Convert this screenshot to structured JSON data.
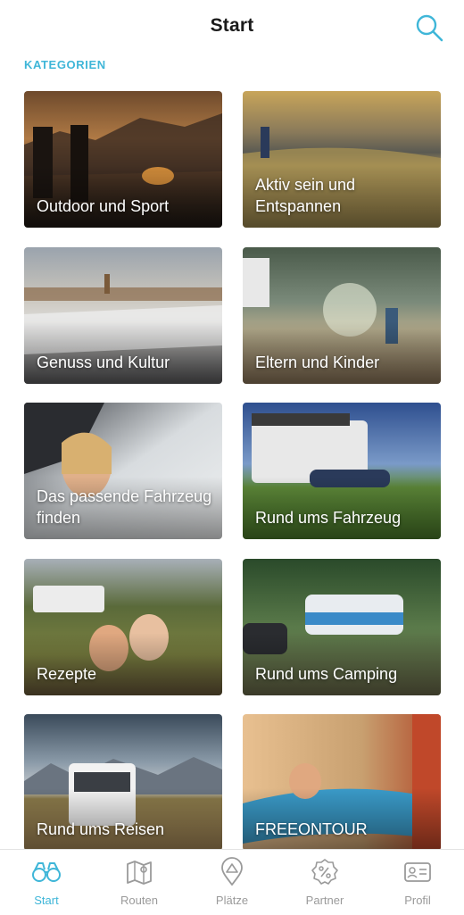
{
  "header": {
    "title": "Start",
    "search_icon": "search-icon"
  },
  "section": {
    "label": "KATEGORIEN"
  },
  "categories": [
    {
      "label": "Outdoor und Sport"
    },
    {
      "label": "Aktiv sein und Entspannen"
    },
    {
      "label": "Genuss und Kultur"
    },
    {
      "label": "Eltern und Kinder"
    },
    {
      "label": "Das passende Fahrzeug finden"
    },
    {
      "label": "Rund ums Fahrzeug"
    },
    {
      "label": "Rezepte"
    },
    {
      "label": "Rund ums Camping"
    },
    {
      "label": "Rund ums Reisen"
    },
    {
      "label": "FREEONTOUR"
    }
  ],
  "tabbar": {
    "items": [
      {
        "label": "Start",
        "icon": "binoculars-icon",
        "active": true
      },
      {
        "label": "Routen",
        "icon": "map-icon",
        "active": false
      },
      {
        "label": "Plätze",
        "icon": "tent-pin-icon",
        "active": false
      },
      {
        "label": "Partner",
        "icon": "percent-badge-icon",
        "active": false
      },
      {
        "label": "Profil",
        "icon": "id-card-icon",
        "active": false
      }
    ]
  },
  "colors": {
    "accent": "#3fb6d8",
    "inactive": "#9a9a9a"
  }
}
